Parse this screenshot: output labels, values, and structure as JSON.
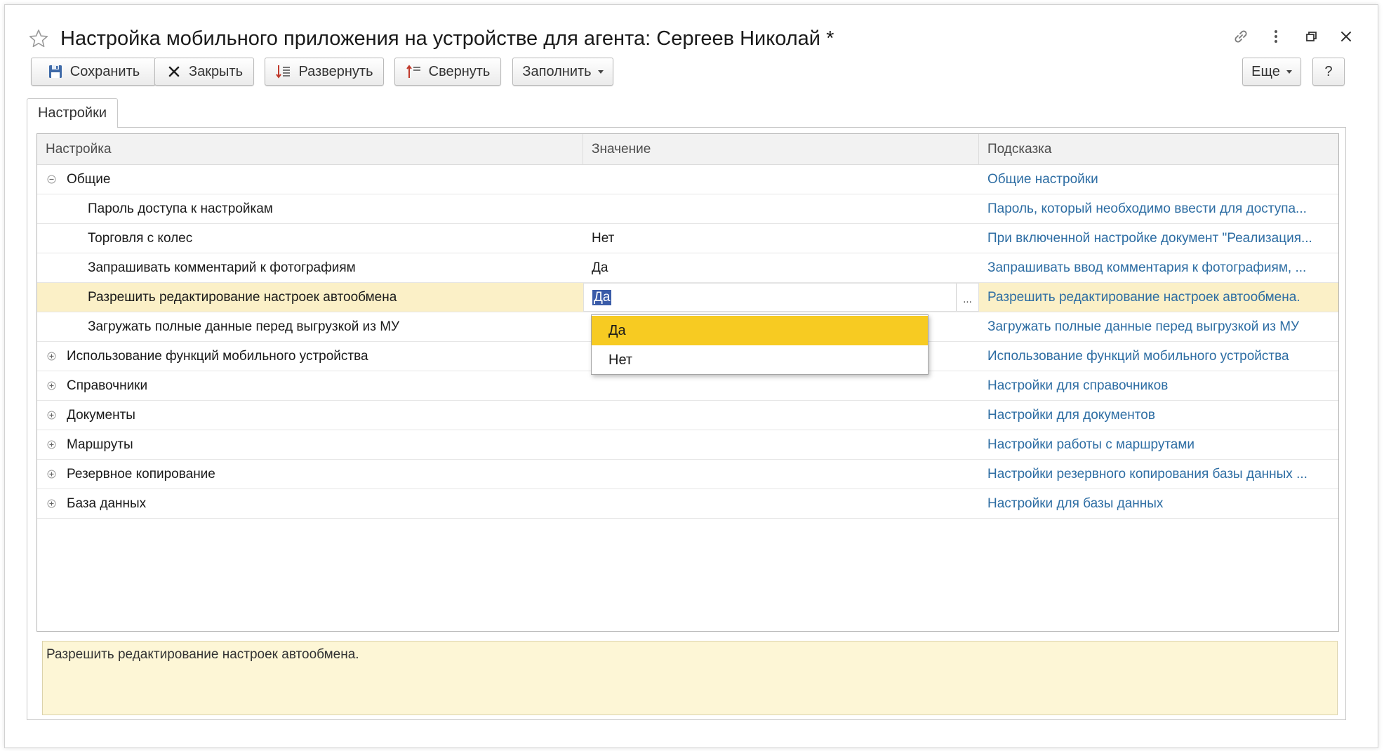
{
  "window": {
    "title": "Настройка мобильного приложения на устройстве для агента: Сергеев Николай *"
  },
  "icons": {
    "favorite": "star-icon",
    "link": "link-icon",
    "more": "more-vertical-icon",
    "restore": "restore-window-icon",
    "close": "close-icon"
  },
  "toolbar": {
    "save_label": "Сохранить",
    "close_label": "Закрыть",
    "expand_label": "Развернуть",
    "collapse_label": "Свернуть",
    "fill_label": "Заполнить",
    "more_label": "Еще",
    "help_label": "?"
  },
  "tabs": [
    {
      "label": "Настройки"
    }
  ],
  "table": {
    "columns": [
      "Настройка",
      "Значение",
      "Подсказка"
    ],
    "rows": [
      {
        "name": "Общие",
        "value": "",
        "hint": "Общие настройки"
      },
      {
        "name": "Пароль доступа к настройкам",
        "value": "",
        "hint": "Пароль, который необходимо ввести для доступа..."
      },
      {
        "name": "Торговля с колес",
        "value": "Нет",
        "hint": "При включенной настройке документ \"Реализация..."
      },
      {
        "name": "Запрашивать комментарий к фотографиям",
        "value": "Да",
        "hint": "Запрашивать ввод комментария к фотографиям, ..."
      },
      {
        "name": "Разрешить редактирование настроек автообмена",
        "value": "Да",
        "hint": "Разрешить редактирование настроек автообмена."
      },
      {
        "name": "Загружать полные данные перед выгрузкой из МУ",
        "value": "",
        "hint": "Загружать полные данные перед выгрузкой из МУ"
      },
      {
        "name": "Использование функций мобильного устройства",
        "value": "",
        "hint": "Использование функций мобильного устройства"
      },
      {
        "name": "Справочники",
        "value": "",
        "hint": "Настройки для справочников"
      },
      {
        "name": "Документы",
        "value": "",
        "hint": "Настройки для документов"
      },
      {
        "name": "Маршруты",
        "value": "",
        "hint": "Настройки работы с маршрутами"
      },
      {
        "name": "Резервное копирование",
        "value": "",
        "hint": "Настройки резервного копирования базы данных ..."
      },
      {
        "name": "База данных",
        "value": "",
        "hint": "Настройки для базы данных"
      }
    ]
  },
  "editor": {
    "value": "Да",
    "choice_button": "..."
  },
  "dropdown": {
    "options": [
      "Да",
      "Нет"
    ],
    "highlighted": "Да"
  },
  "description": "Разрешить редактирование настроек автообмена.",
  "colors": {
    "selected_row": "#fbf0c7",
    "dropdown_highlight": "#f7cb22",
    "hint_link": "#2d6da3",
    "description_bg": "#fdf6d6"
  }
}
